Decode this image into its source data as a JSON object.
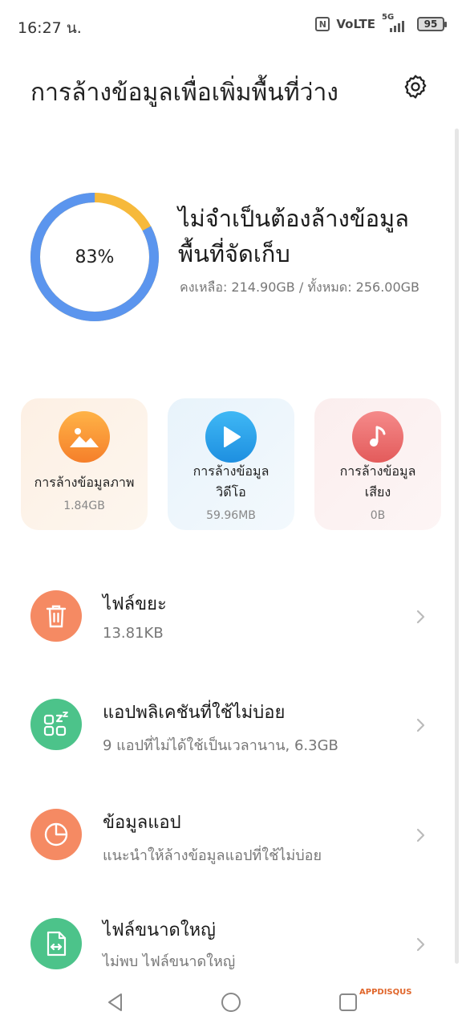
{
  "status_bar": {
    "time": "16:27 น.",
    "nfc_icon": "N",
    "volte": "VoLTE",
    "network": "5G",
    "battery": "95"
  },
  "header": {
    "title": "การล้างข้อมูลเพื่อเพิ่มพื้นที่ว่าง",
    "settings_icon": "gear-icon"
  },
  "storage": {
    "percent_label": "83%",
    "used_fraction": 0.83,
    "status_line1": "ไม่จำเป็นต้องล้างข้อมูล",
    "status_line2": "พื้นที่จัดเก็บ",
    "detail": "คงเหลือ: 214.90GB / ทั้งหมด: 256.00GB",
    "colors": {
      "used": "#5b95ee",
      "remaining": "#f6b93b"
    }
  },
  "cards": [
    {
      "label": "การล้างข้อมูลภาพ",
      "size": "1.84GB",
      "icon": "image-icon",
      "color": "#f5902f"
    },
    {
      "label": "การล้างข้อมูลวิดีโอ",
      "size": "59.96MB",
      "icon": "play-icon",
      "color": "#2a9fe8"
    },
    {
      "label": "การล้างข้อมูลเสียง",
      "size": "0B",
      "icon": "music-note-icon",
      "color": "#ea6a6a"
    }
  ],
  "list": [
    {
      "title": "ไฟล์ขยะ",
      "subtitle": "13.81KB",
      "icon": "trash-icon",
      "color": "#f58a63"
    },
    {
      "title": "แอปพลิเคชันที่ใช้ไม่บ่อย",
      "subtitle": "9 แอปที่ไม่ได้ใช้เป็นเวลานาน, 6.3GB",
      "icon": "sleep-apps-icon",
      "color": "#4cc38a"
    },
    {
      "title": "ข้อมูลแอป",
      "subtitle": "แนะนำให้ล้างข้อมูลแอปที่ใช้ไม่บ่อย",
      "icon": "pie-chart-icon",
      "color": "#f58a63"
    },
    {
      "title": "ไฟล์ขนาดใหญ่",
      "subtitle": "ไม่พบ ไฟล์ขนาดใหญ่",
      "icon": "large-file-icon",
      "color": "#4cc38a"
    }
  ],
  "nav": {
    "back_icon": "back-triangle-icon",
    "home_icon": "home-circle-icon",
    "recents_icon": "recents-square-icon"
  },
  "watermark": "APPDISQUS"
}
